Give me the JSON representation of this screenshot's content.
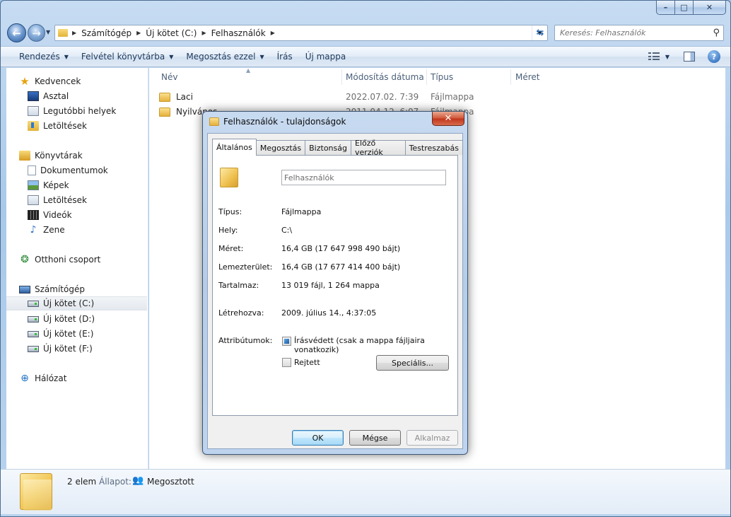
{
  "window": {
    "minimize": "–",
    "maximize": "□",
    "close": "✕"
  },
  "address": {
    "crumbs": [
      "Számítógép",
      "Új kötet (C:)",
      "Felhasználók"
    ]
  },
  "search": {
    "placeholder": "Keresés: Felhasználók"
  },
  "toolbar": {
    "organize": "Rendezés",
    "include_library": "Felvétel könyvtárba",
    "share_with": "Megosztás ezzel",
    "burn": "Írás",
    "new_folder": "Új mappa"
  },
  "sidebar": {
    "favorites": {
      "label": "Kedvencek",
      "items": [
        "Asztal",
        "Legutóbbi helyek",
        "Letöltések"
      ]
    },
    "libraries": {
      "label": "Könyvtárak",
      "items": [
        "Dokumentumok",
        "Képek",
        "Letöltések",
        "Videók",
        "Zene"
      ]
    },
    "homegroup": {
      "label": "Otthoni csoport"
    },
    "computer": {
      "label": "Számítógép",
      "items": [
        "Új kötet (C:)",
        "Új kötet (D:)",
        "Új kötet (E:)",
        "Új kötet (F:)"
      ]
    },
    "network": {
      "label": "Hálózat"
    }
  },
  "columns": {
    "name": "Név",
    "modified": "Módosítás dátuma",
    "type": "Típus",
    "size": "Méret"
  },
  "files": [
    {
      "name": "Laci",
      "date": "2022.07.02. 7:39",
      "type": "Fájlmappa"
    },
    {
      "name": "Nyilvános",
      "date": "2011.04.12. 6:07",
      "type": "Fájlmappa"
    }
  ],
  "details": {
    "count": "2 elem",
    "state_label": "Állapot:",
    "state_value": "Megosztott"
  },
  "dialog": {
    "title": "Felhasználók - tulajdonságok",
    "close": "✕",
    "tabs": [
      "Általános",
      "Megosztás",
      "Biztonság",
      "Előző verziók",
      "Testreszabás"
    ],
    "active_tab": "Általános",
    "name_value": "Felhasználók",
    "props": {
      "type_label": "Típus:",
      "type_value": "Fájlmappa",
      "location_label": "Hely:",
      "location_value": "C:\\",
      "size_label": "Méret:",
      "size_value": "16,4 GB (17 647 998 490 bájt)",
      "disk_label": "Lemezterület:",
      "disk_value": "16,4 GB (17 677 414 400 bájt)",
      "contains_label": "Tartalmaz:",
      "contains_value": "13 019 fájl, 1 264 mappa",
      "created_label": "Létrehozva:",
      "created_value": "2009. július 14., 4:37:05",
      "attributes_label": "Attribútumok:"
    },
    "readonly_label": "Írásvédett (csak a mappa fájljaira vonatkozik)",
    "readonly_state": "indeterminate",
    "hidden_label": "Rejtett",
    "hidden_state": "unchecked",
    "advanced_button": "Speciális...",
    "ok_button": "OK",
    "cancel_button": "Mégse",
    "apply_button": "Alkalmaz"
  }
}
